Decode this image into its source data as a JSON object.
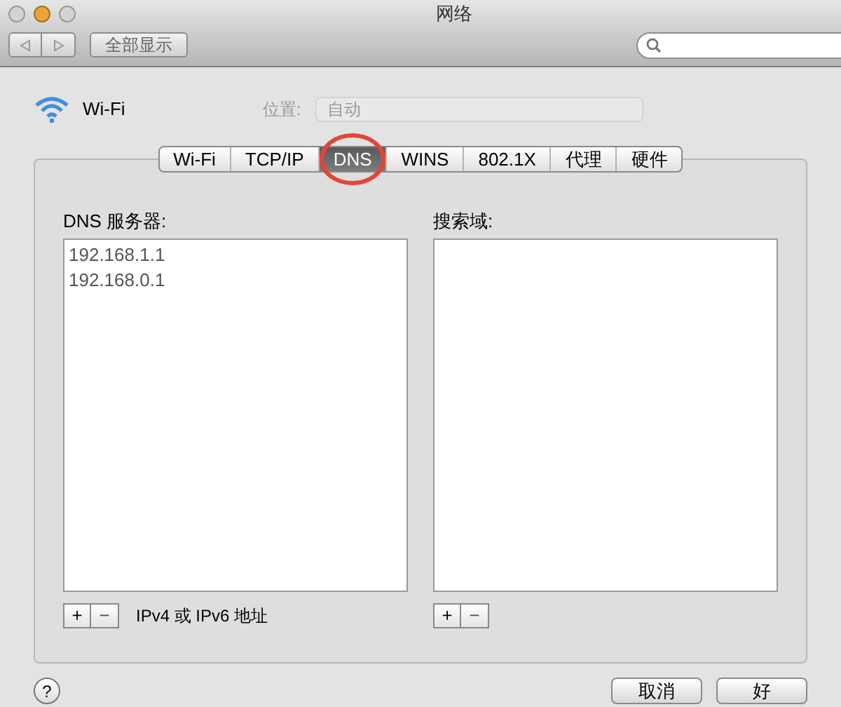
{
  "window": {
    "title": "网络"
  },
  "toolbar": {
    "show_all": "全部显示"
  },
  "service": {
    "name": "Wi-Fi"
  },
  "location": {
    "label": "位置:",
    "value": "自动"
  },
  "tabs": [
    {
      "label": "Wi-Fi",
      "selected": false
    },
    {
      "label": "TCP/IP",
      "selected": false
    },
    {
      "label": "DNS",
      "selected": true,
      "highlighted": true
    },
    {
      "label": "WINS",
      "selected": false
    },
    {
      "label": "802.1X",
      "selected": false
    },
    {
      "label": "代理",
      "selected": false
    },
    {
      "label": "硬件",
      "selected": false
    }
  ],
  "dns_servers": {
    "label": "DNS 服务器:",
    "items": [
      "192.168.1.1",
      "192.168.0.1"
    ],
    "hint": "IPv4 或 IPv6 地址",
    "add": "+",
    "remove": "−"
  },
  "search_domains": {
    "label": "搜索域:",
    "add": "+",
    "remove": "−"
  },
  "help": "?",
  "buttons": [
    "取消",
    "好"
  ]
}
